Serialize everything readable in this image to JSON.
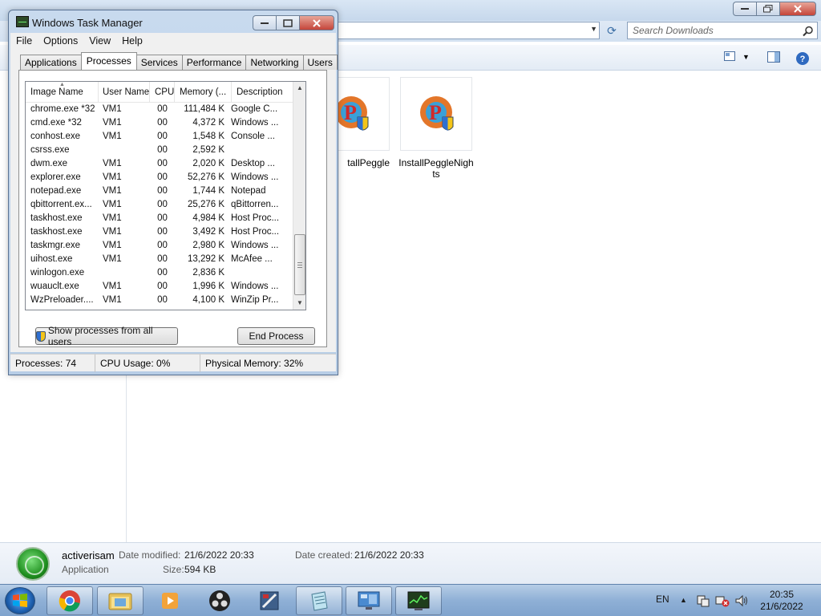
{
  "explorer": {
    "search_placeholder": "Search Downloads",
    "files": [
      {
        "name": "tallPeggle"
      },
      {
        "name": "InstallPeggleNights"
      }
    ],
    "details": {
      "name": "activerisam",
      "type": "Application",
      "date_modified_label": "Date modified:",
      "date_modified": "21/6/2022 20:33",
      "date_created_label": "Date created:",
      "date_created": "21/6/2022 20:33",
      "size_label": "Size:",
      "size": "594 KB"
    }
  },
  "taskmgr": {
    "title": "Windows Task Manager",
    "menu": [
      "File",
      "Options",
      "View",
      "Help"
    ],
    "tabs": [
      "Applications",
      "Processes",
      "Services",
      "Performance",
      "Networking",
      "Users"
    ],
    "active_tab": "Processes",
    "columns": [
      "Image Name",
      "User Name",
      "CPU",
      "Memory (...",
      "Description"
    ],
    "rows": [
      {
        "name": "chrome.exe *32",
        "user": "VM1",
        "cpu": "00",
        "mem": "111,484 K",
        "desc": "Google C..."
      },
      {
        "name": "cmd.exe *32",
        "user": "VM1",
        "cpu": "00",
        "mem": "4,372 K",
        "desc": "Windows ..."
      },
      {
        "name": "conhost.exe",
        "user": "VM1",
        "cpu": "00",
        "mem": "1,548 K",
        "desc": "Console ..."
      },
      {
        "name": "csrss.exe",
        "user": "",
        "cpu": "00",
        "mem": "2,592 K",
        "desc": ""
      },
      {
        "name": "dwm.exe",
        "user": "VM1",
        "cpu": "00",
        "mem": "2,020 K",
        "desc": "Desktop ..."
      },
      {
        "name": "explorer.exe",
        "user": "VM1",
        "cpu": "00",
        "mem": "52,276 K",
        "desc": "Windows ..."
      },
      {
        "name": "notepad.exe",
        "user": "VM1",
        "cpu": "00",
        "mem": "1,744 K",
        "desc": "Notepad"
      },
      {
        "name": "qbittorrent.ex...",
        "user": "VM1",
        "cpu": "00",
        "mem": "25,276 K",
        "desc": "qBittorren..."
      },
      {
        "name": "taskhost.exe",
        "user": "VM1",
        "cpu": "00",
        "mem": "4,984 K",
        "desc": "Host Proc..."
      },
      {
        "name": "taskhost.exe",
        "user": "VM1",
        "cpu": "00",
        "mem": "3,492 K",
        "desc": "Host Proc..."
      },
      {
        "name": "taskmgr.exe",
        "user": "VM1",
        "cpu": "00",
        "mem": "2,980 K",
        "desc": "Windows ..."
      },
      {
        "name": "uihost.exe",
        "user": "VM1",
        "cpu": "00",
        "mem": "13,292 K",
        "desc": "McAfee ..."
      },
      {
        "name": "winlogon.exe",
        "user": "",
        "cpu": "00",
        "mem": "2,836 K",
        "desc": ""
      },
      {
        "name": "wuauclt.exe",
        "user": "VM1",
        "cpu": "00",
        "mem": "1,996 K",
        "desc": "Windows ..."
      },
      {
        "name": "WzPreloader....",
        "user": "VM1",
        "cpu": "00",
        "mem": "4,100 K",
        "desc": "WinZip Pr..."
      }
    ],
    "show_all_label": "Show processes from all users",
    "end_process_label": "End Process",
    "status": {
      "processes": "Processes: 74",
      "cpu": "CPU Usage: 0%",
      "memory": "Physical Memory: 32%"
    }
  },
  "taskbar": {
    "language": "EN",
    "time": "20:35",
    "date": "21/6/2022"
  }
}
